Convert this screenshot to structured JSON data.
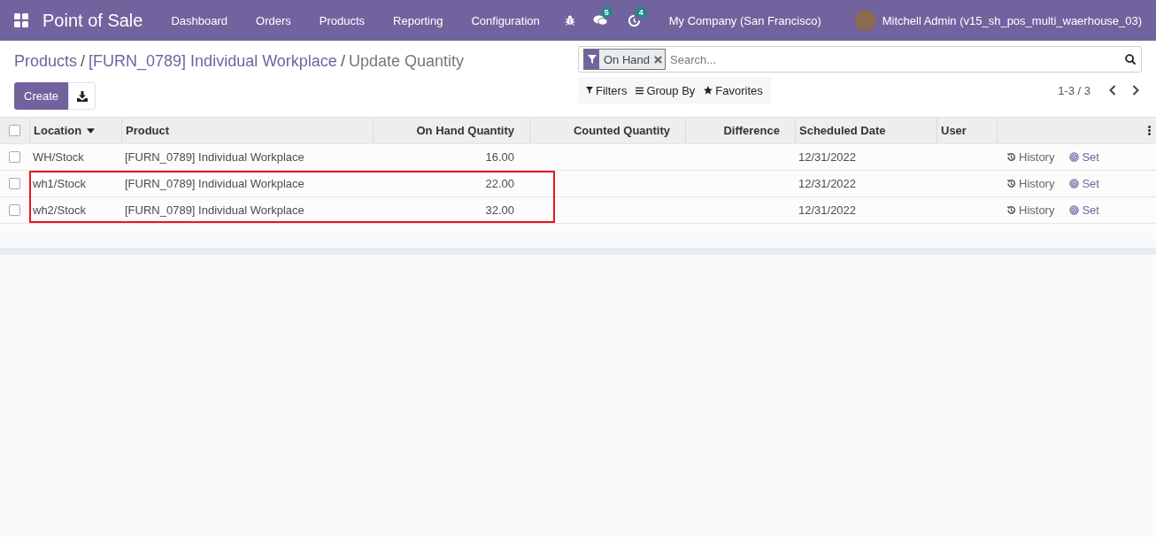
{
  "navbar": {
    "app_name": "Point of Sale",
    "menu": [
      "Dashboard",
      "Orders",
      "Products",
      "Reporting",
      "Configuration"
    ],
    "messages_badge": "5",
    "activities_badge": "4",
    "company": "My Company (San Francisco)",
    "user": "Mitchell Admin (v15_sh_pos_multi_waerhouse_03)"
  },
  "breadcrumb": [
    "Products",
    "[FURN_0789] Individual Workplace",
    "Update Quantity"
  ],
  "breadcrumb_separators": [
    "/",
    "/"
  ],
  "buttons": {
    "create": "Create"
  },
  "search": {
    "facet": "On Hand",
    "placeholder": "Search..."
  },
  "search_options": [
    "Filters",
    "Group By",
    "Favorites"
  ],
  "pager": "1-3 / 3",
  "table": {
    "select_all_checked": false,
    "columns": [
      {
        "label": "Location",
        "sorted": true
      },
      {
        "label": "Product",
        "sorted": false
      },
      {
        "label": "On Hand Quantity",
        "sorted": false
      },
      {
        "label": "Counted Quantity",
        "sorted": false
      },
      {
        "label": "Difference",
        "sorted": false
      },
      {
        "label": "Scheduled Date",
        "sorted": false
      },
      {
        "label": "User",
        "sorted": false
      }
    ],
    "rows": [
      {
        "checked": false,
        "highlighted": false,
        "cells": [
          "WH/Stock",
          "[FURN_0789] Individual Workplace",
          "16.00",
          "",
          "",
          "12/31/2022",
          ""
        ],
        "history": "History",
        "set": "Set"
      },
      {
        "checked": false,
        "highlighted": true,
        "cells": [
          "wh1/Stock",
          "[FURN_0789] Individual Workplace",
          "22.00",
          "",
          "",
          "12/31/2022",
          ""
        ],
        "history": "History",
        "set": "Set"
      },
      {
        "checked": false,
        "highlighted": true,
        "cells": [
          "wh2/Stock",
          "[FURN_0789] Individual Workplace",
          "32.00",
          "",
          "",
          "12/31/2022",
          ""
        ],
        "history": "History",
        "set": "Set"
      }
    ]
  }
}
